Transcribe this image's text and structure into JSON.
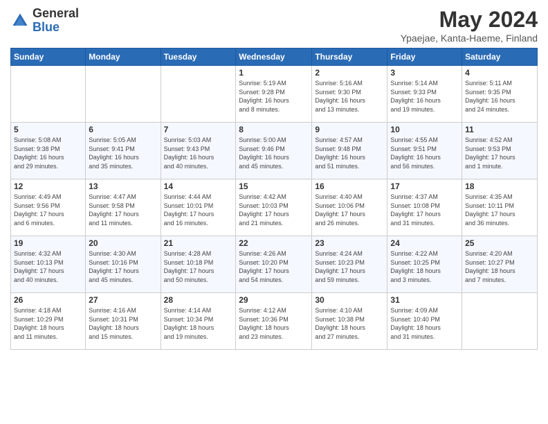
{
  "header": {
    "logo_general": "General",
    "logo_blue": "Blue",
    "title": "May 2024",
    "location": "Ypaejae, Kanta-Haeme, Finland"
  },
  "days_of_week": [
    "Sunday",
    "Monday",
    "Tuesday",
    "Wednesday",
    "Thursday",
    "Friday",
    "Saturday"
  ],
  "weeks": [
    [
      {
        "day": "",
        "info": ""
      },
      {
        "day": "",
        "info": ""
      },
      {
        "day": "",
        "info": ""
      },
      {
        "day": "1",
        "info": "Sunrise: 5:19 AM\nSunset: 9:28 PM\nDaylight: 16 hours\nand 8 minutes."
      },
      {
        "day": "2",
        "info": "Sunrise: 5:16 AM\nSunset: 9:30 PM\nDaylight: 16 hours\nand 13 minutes."
      },
      {
        "day": "3",
        "info": "Sunrise: 5:14 AM\nSunset: 9:33 PM\nDaylight: 16 hours\nand 19 minutes."
      },
      {
        "day": "4",
        "info": "Sunrise: 5:11 AM\nSunset: 9:35 PM\nDaylight: 16 hours\nand 24 minutes."
      }
    ],
    [
      {
        "day": "5",
        "info": "Sunrise: 5:08 AM\nSunset: 9:38 PM\nDaylight: 16 hours\nand 29 minutes."
      },
      {
        "day": "6",
        "info": "Sunrise: 5:05 AM\nSunset: 9:41 PM\nDaylight: 16 hours\nand 35 minutes."
      },
      {
        "day": "7",
        "info": "Sunrise: 5:03 AM\nSunset: 9:43 PM\nDaylight: 16 hours\nand 40 minutes."
      },
      {
        "day": "8",
        "info": "Sunrise: 5:00 AM\nSunset: 9:46 PM\nDaylight: 16 hours\nand 45 minutes."
      },
      {
        "day": "9",
        "info": "Sunrise: 4:57 AM\nSunset: 9:48 PM\nDaylight: 16 hours\nand 51 minutes."
      },
      {
        "day": "10",
        "info": "Sunrise: 4:55 AM\nSunset: 9:51 PM\nDaylight: 16 hours\nand 56 minutes."
      },
      {
        "day": "11",
        "info": "Sunrise: 4:52 AM\nSunset: 9:53 PM\nDaylight: 17 hours\nand 1 minute."
      }
    ],
    [
      {
        "day": "12",
        "info": "Sunrise: 4:49 AM\nSunset: 9:56 PM\nDaylight: 17 hours\nand 6 minutes."
      },
      {
        "day": "13",
        "info": "Sunrise: 4:47 AM\nSunset: 9:58 PM\nDaylight: 17 hours\nand 11 minutes."
      },
      {
        "day": "14",
        "info": "Sunrise: 4:44 AM\nSunset: 10:01 PM\nDaylight: 17 hours\nand 16 minutes."
      },
      {
        "day": "15",
        "info": "Sunrise: 4:42 AM\nSunset: 10:03 PM\nDaylight: 17 hours\nand 21 minutes."
      },
      {
        "day": "16",
        "info": "Sunrise: 4:40 AM\nSunset: 10:06 PM\nDaylight: 17 hours\nand 26 minutes."
      },
      {
        "day": "17",
        "info": "Sunrise: 4:37 AM\nSunset: 10:08 PM\nDaylight: 17 hours\nand 31 minutes."
      },
      {
        "day": "18",
        "info": "Sunrise: 4:35 AM\nSunset: 10:11 PM\nDaylight: 17 hours\nand 36 minutes."
      }
    ],
    [
      {
        "day": "19",
        "info": "Sunrise: 4:32 AM\nSunset: 10:13 PM\nDaylight: 17 hours\nand 40 minutes."
      },
      {
        "day": "20",
        "info": "Sunrise: 4:30 AM\nSunset: 10:16 PM\nDaylight: 17 hours\nand 45 minutes."
      },
      {
        "day": "21",
        "info": "Sunrise: 4:28 AM\nSunset: 10:18 PM\nDaylight: 17 hours\nand 50 minutes."
      },
      {
        "day": "22",
        "info": "Sunrise: 4:26 AM\nSunset: 10:20 PM\nDaylight: 17 hours\nand 54 minutes."
      },
      {
        "day": "23",
        "info": "Sunrise: 4:24 AM\nSunset: 10:23 PM\nDaylight: 17 hours\nand 59 minutes."
      },
      {
        "day": "24",
        "info": "Sunrise: 4:22 AM\nSunset: 10:25 PM\nDaylight: 18 hours\nand 3 minutes."
      },
      {
        "day": "25",
        "info": "Sunrise: 4:20 AM\nSunset: 10:27 PM\nDaylight: 18 hours\nand 7 minutes."
      }
    ],
    [
      {
        "day": "26",
        "info": "Sunrise: 4:18 AM\nSunset: 10:29 PM\nDaylight: 18 hours\nand 11 minutes."
      },
      {
        "day": "27",
        "info": "Sunrise: 4:16 AM\nSunset: 10:31 PM\nDaylight: 18 hours\nand 15 minutes."
      },
      {
        "day": "28",
        "info": "Sunrise: 4:14 AM\nSunset: 10:34 PM\nDaylight: 18 hours\nand 19 minutes."
      },
      {
        "day": "29",
        "info": "Sunrise: 4:12 AM\nSunset: 10:36 PM\nDaylight: 18 hours\nand 23 minutes."
      },
      {
        "day": "30",
        "info": "Sunrise: 4:10 AM\nSunset: 10:38 PM\nDaylight: 18 hours\nand 27 minutes."
      },
      {
        "day": "31",
        "info": "Sunrise: 4:09 AM\nSunset: 10:40 PM\nDaylight: 18 hours\nand 31 minutes."
      },
      {
        "day": "",
        "info": ""
      }
    ]
  ]
}
